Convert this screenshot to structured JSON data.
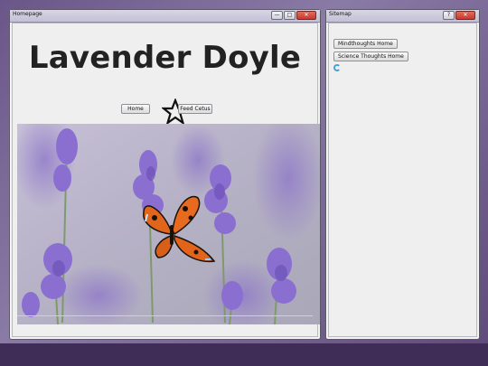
{
  "homepage_window": {
    "title": "Homepage",
    "controls": {
      "minimize": "—",
      "maximize": "□",
      "close": "✕"
    },
    "site_title": "Lavender Doyle",
    "nav": {
      "home_label": "Home",
      "feed_label": "Feed Cetus"
    },
    "star_icon": "star-icon",
    "photo": "butterfly-on-lavender"
  },
  "sitemap_window": {
    "title": "Sitemap",
    "controls": {
      "help": "?",
      "close": "✕"
    },
    "links": [
      "Mindthoughts Home",
      "Science Thoughts Home"
    ],
    "loading_icon": "spinner-icon"
  }
}
